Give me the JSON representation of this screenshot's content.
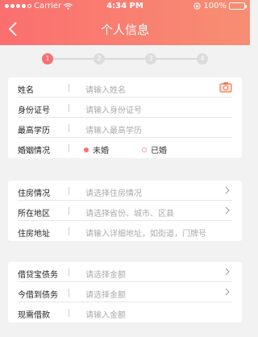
{
  "status_bar": {
    "carrier": "Carrier",
    "time": "4:34 PM",
    "battery": "100%"
  },
  "header": {
    "title": "个人信息"
  },
  "steps": [
    "1",
    "2",
    "3",
    "4"
  ],
  "personal": [
    {
      "label": "姓名",
      "placeholder": "请输入姓名"
    },
    {
      "label": "身份证号",
      "placeholder": "请输入身份证号"
    },
    {
      "label": "最高学历",
      "placeholder": "请输入最高学历"
    }
  ],
  "marital": {
    "label": "婚姻情况",
    "option_unmarried": "未婚",
    "option_married": "已婚",
    "selected": "未婚"
  },
  "housing": [
    {
      "label": "住房情况",
      "placeholder": "请选择住房情况"
    },
    {
      "label": "所在地区",
      "placeholder": "请选择省份、城市、区县"
    },
    {
      "label": "住房地址",
      "placeholder": "请输入详细地址，如街道，门牌号"
    }
  ],
  "debts": [
    {
      "label": "借贷宝债务",
      "placeholder": "请选择金额"
    },
    {
      "label": "今借到债务",
      "placeholder": "请选择金额"
    },
    {
      "label": "现需借款",
      "placeholder": "请输入金额"
    }
  ],
  "colors": {
    "accent": "#f96f6f",
    "header_start": "#fb6f6f",
    "header_end": "#f78e73"
  },
  "icons": {
    "back": "back-arrow-icon",
    "camera": "camera-icon",
    "chevron": "chevron-right-icon"
  }
}
